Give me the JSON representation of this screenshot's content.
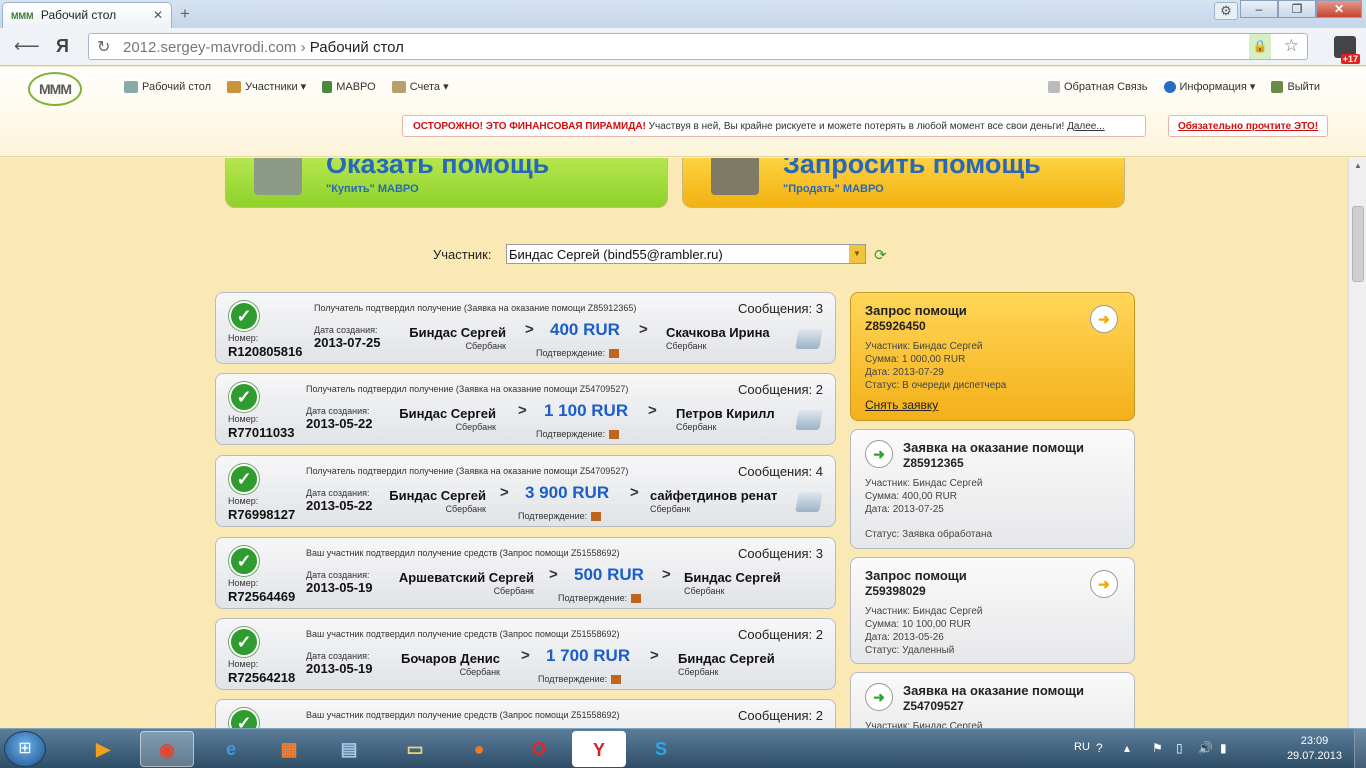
{
  "browser": {
    "tab_title": "Рабочий стол",
    "tab_favicon": "MMM",
    "url_domain": "2012.sergey-mavrodi.com",
    "url_separator": "›",
    "url_path": "Рабочий стол",
    "yandex_letter": "Я",
    "extension_badge": "+17"
  },
  "header": {
    "logo_text": "MMM",
    "menu_left": [
      {
        "label": "Рабочий стол",
        "icon": "desktop-icon"
      },
      {
        "label": "Участники ▾",
        "icon": "users-icon"
      },
      {
        "label": "МАВРО",
        "icon": "mavro-icon"
      },
      {
        "label": "Счета ▾",
        "icon": "accounts-icon"
      }
    ],
    "menu_right": [
      {
        "label": "Обратная Связь",
        "icon": "feedback-icon"
      },
      {
        "label": "Информация ▾",
        "icon": "info-icon"
      },
      {
        "label": "Выйти",
        "icon": "exit-icon"
      }
    ],
    "warning_red": "ОСТОРОЖНО! ЭТО ФИНАНСОВАЯ ПИРАМИДА!",
    "warning_text": " Участвуя в ней, Вы крайне рискуете и можете потерять в любой момент все свои деньги! ",
    "warning_more": "Далее...",
    "must_read": "Обязательно прочтите ЭТО!"
  },
  "actions": {
    "give_title": "Оказать помощь",
    "give_sub": "\"Купить\" МАВРО",
    "request_title": "Запросить помощь",
    "request_sub": "\"Продать\" МАВРО"
  },
  "participant": {
    "label": "Участник:",
    "value": "Биндас Сергей (bind55@rambler.ru)"
  },
  "labels": {
    "number": "Номер:",
    "created": "Дата создания:",
    "confirmation": "Подтверждение:",
    "gt": ">"
  },
  "transactions": [
    {
      "status": "Получатель подтвердил получение (Заявка на оказание помощи Z85912365)",
      "messages": "Сообщения: 3",
      "number": "R120805816",
      "date": "2013-07-25",
      "from": "Биндас Сергей",
      "from_bank": "Сбербанк",
      "amount": "400 RUR",
      "to": "Скачкова Ирина",
      "to_bank": "Сбербанк"
    },
    {
      "status": "Получатель подтвердил получение (Заявка на оказание помощи Z54709527)",
      "messages": "Сообщения: 2",
      "number": "R77011033",
      "date": "2013-05-22",
      "from": "Биндас Сергей",
      "from_bank": "Сбербанк",
      "amount": "1 100 RUR",
      "to": "Петров Кирилл",
      "to_bank": "Сбербанк"
    },
    {
      "status": "Получатель подтвердил получение (Заявка на оказание помощи Z54709527)",
      "messages": "Сообщения: 4",
      "number": "R76998127",
      "date": "2013-05-22",
      "from": "Биндас Сергей",
      "from_bank": "Сбербанк",
      "amount": "3 900 RUR",
      "to": "сайфетдинов ренат",
      "to_bank": "Сбербанк"
    },
    {
      "status": "Ваш участник подтвердил получение средств (Запрос помощи Z51558692)",
      "messages": "Сообщения: 3",
      "number": "R72564469",
      "date": "2013-05-19",
      "from": "Аршеватский Сергей",
      "from_bank": "Сбербанк",
      "amount": "500 RUR",
      "to": "Биндас Сергей",
      "to_bank": "Сбербанк"
    },
    {
      "status": "Ваш участник подтвердил получение средств (Запрос помощи Z51558692)",
      "messages": "Сообщения: 2",
      "number": "R72564218",
      "date": "2013-05-19",
      "from": "Бочаров Денис",
      "from_bank": "Сбербанк",
      "amount": "1 700 RUR",
      "to": "Биндас Сергей",
      "to_bank": "Сбербанк"
    },
    {
      "status": "Ваш участник подтвердил получение средств (Запрос помощи Z51558692)",
      "messages": "Сообщения: 2",
      "number": "",
      "date": "",
      "from": "",
      "from_bank": "",
      "amount": "",
      "to": "",
      "to_bank": ""
    }
  ],
  "requests": [
    {
      "title": "Запрос помощи",
      "id": "Z85926450",
      "participant": "Участник: Биндас Сергей",
      "sum": "Сумма: 1 000,00 RUR",
      "date": "Дата: 2013-07-29",
      "status": "Статус: В очереди диспетчера",
      "cancel": "Снять заявку"
    },
    {
      "title": "Заявка на оказание помощи",
      "id": "Z85912365",
      "participant": "Участник: Биндас Сергей",
      "sum": "Сумма: 400,00 RUR",
      "date": "Дата: 2013-07-25",
      "status": "Статус: Заявка обработана"
    },
    {
      "title": "Запрос помощи",
      "id": "Z59398029",
      "participant": "Участник: Биндас Сергей",
      "sum": "Сумма: 10 100,00 RUR",
      "date": "Дата: 2013-05-26",
      "status": "Статус: Удаленный"
    },
    {
      "title": "Заявка на оказание помощи",
      "id": "Z54709527",
      "participant": "Участник: Биндас Сергей"
    }
  ],
  "taskbar": {
    "lang": "RU",
    "time": "23:09",
    "date": "29.07.2013"
  }
}
